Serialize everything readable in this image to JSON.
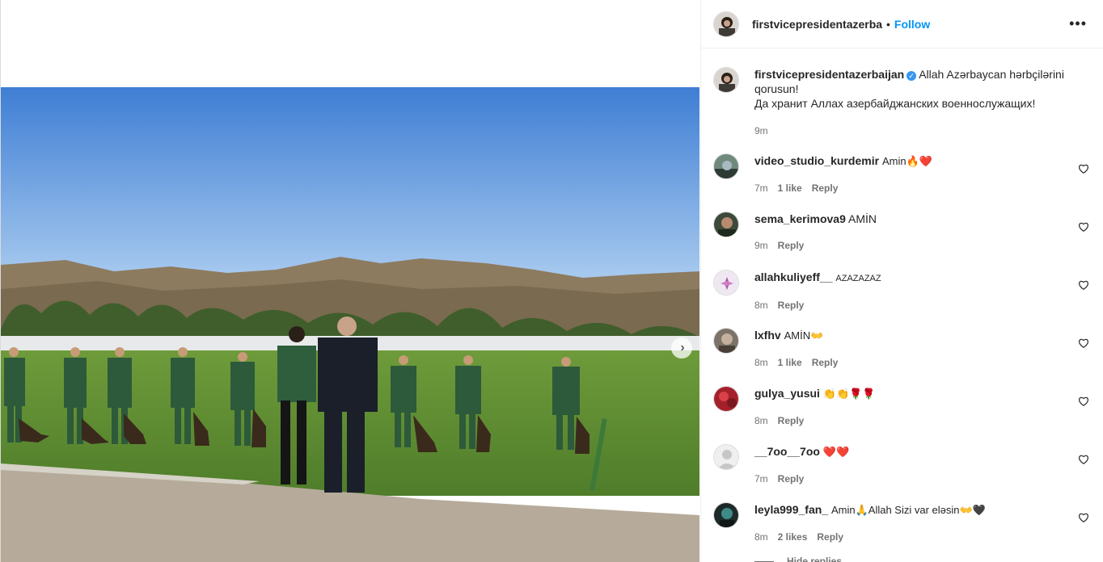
{
  "post": {
    "author": "firstvicepresidentazerbaijan",
    "follow_label": "Follow",
    "header_separator": "•",
    "more_label": "•••",
    "next_glyph": "›",
    "caption": {
      "line1": "Allah Azərbaycan hərbçilərini qorusun!",
      "line2": "Да хранит Аллах азербайджанских военнослужащих!",
      "time": "9m"
    }
  },
  "comments": [
    {
      "user": "video_studio_kurdemir",
      "text": "Amin🔥❤️",
      "time": "7m",
      "likes": "1 like",
      "reply": "Reply",
      "avatar_color": "#6f8a7c"
    },
    {
      "user": "sema_kerimova9",
      "text": "AMİN",
      "time": "9m",
      "likes": "",
      "reply": "Reply",
      "avatar_color": "#3d4a3b"
    },
    {
      "user": "allahkuliyeff__",
      "text": "AZAZAZAZ",
      "time": "8m",
      "likes": "",
      "reply": "Reply",
      "avatar_color": "#efe8f2"
    },
    {
      "user": "lxfhv",
      "text": "AMİN👐",
      "time": "8m",
      "likes": "1 like",
      "reply": "Reply",
      "avatar_color": "#7b7268"
    },
    {
      "user": "gulya_yusui",
      "text": "👏👏🌹🌹",
      "time": "8m",
      "likes": "",
      "reply": "Reply",
      "avatar_color": "#a4212a"
    },
    {
      "user": "__7oo__7oo",
      "text": "❤️❤️",
      "time": "7m",
      "likes": "",
      "reply": "Reply",
      "avatar_color": "#d8d8d8"
    },
    {
      "user": "leyla999_fan_",
      "text": "Amin🙏Allah Sizi var eləsin👐🖤",
      "time": "8m",
      "likes": "2 likes",
      "reply": "Reply",
      "avatar_color": "#1e2a2a"
    }
  ],
  "hide_replies": "Hide replies",
  "colors": {
    "accent": "#0095f6",
    "verified": "#3897f0",
    "muted": "#737373"
  }
}
